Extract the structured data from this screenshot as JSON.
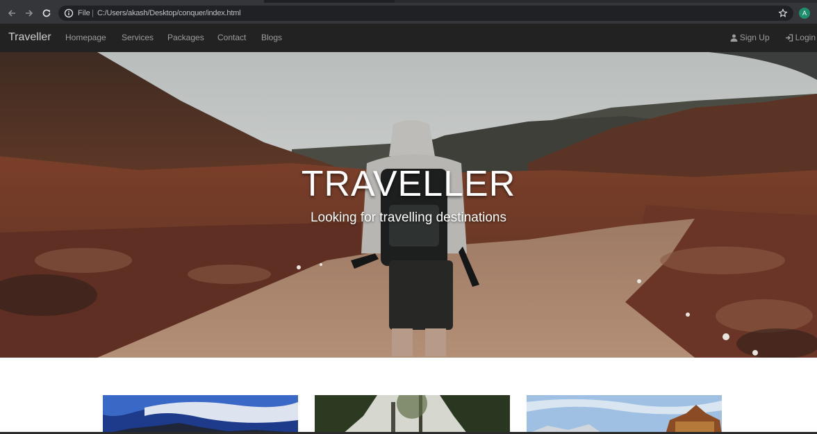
{
  "browser": {
    "scheme_label": "File",
    "separator": "|",
    "url": "C:/Users/akash/Desktop/conquer/index.html",
    "profile_initial": "A",
    "profile_color": "#1e8e6f",
    "icons": [
      "back-icon",
      "forward-icon",
      "reload-icon",
      "info-icon",
      "star-icon"
    ]
  },
  "navbar": {
    "brand": "Traveller",
    "links": [
      "Homepage",
      "Services",
      "Packages",
      "Contact",
      "Blogs"
    ],
    "signup_label": "Sign Up",
    "login_label": "Login",
    "background": "#222222",
    "link_color": "#9d9d9d"
  },
  "hero": {
    "title": "TRAVELLER",
    "subtitle": "Looking for travelling destinations"
  },
  "cards": [
    {
      "image": "mountain-sky-photo"
    },
    {
      "image": "forest-trees-photo"
    },
    {
      "image": "temple-rooftop-photo"
    }
  ]
}
